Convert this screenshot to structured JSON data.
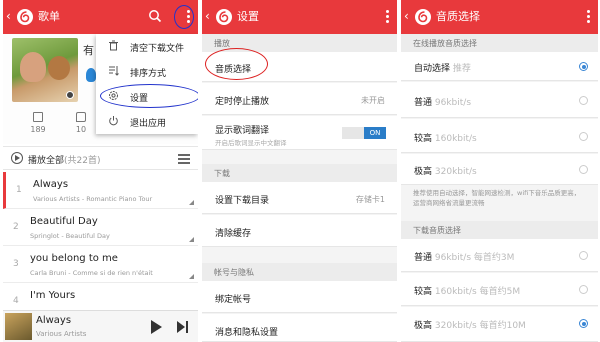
{
  "colors": {
    "accent": "#e8393c",
    "toggle_on": "#2a7dc8",
    "highlight_circle": "#2233cc",
    "radio_checked": "#3a86d4"
  },
  "songlist_screen": {
    "back_icon": "‹",
    "title": "歌单",
    "cover_title": "有",
    "stats": [
      {
        "icon": "favorite-icon",
        "count": "189"
      },
      {
        "icon": "comment-icon",
        "count": "10"
      }
    ],
    "play_all_label": "播放全部",
    "play_all_count": "(共22首)",
    "songs": [
      {
        "number": "1",
        "title": "Always",
        "meta": "Various Artists - Romantic Piano Tour"
      },
      {
        "number": "2",
        "title": "Beautiful Day",
        "meta": "Springlot - Beautiful Day"
      },
      {
        "number": "3",
        "title": "you belong to me",
        "meta": "Carla Bruni - Comme si de rien n'était"
      },
      {
        "number": "4",
        "title": "I'm Yours",
        "meta": ""
      }
    ],
    "now_playing": {
      "title": "Always",
      "artist": "Various Artists"
    },
    "menu": [
      {
        "icon": "trash-icon",
        "label": "清空下载文件"
      },
      {
        "icon": "sort-icon",
        "label": "排序方式"
      },
      {
        "icon": "gear-icon",
        "label": "设置"
      },
      {
        "icon": "power-icon",
        "label": "退出应用"
      }
    ]
  },
  "settings_screen": {
    "back_icon": "‹",
    "title": "设置",
    "sections": {
      "playback": "播放",
      "download": "下载",
      "account": "帐号与隐私"
    },
    "rows": {
      "quality": "音质选择",
      "sleep_timer": "定时停止播放",
      "sleep_timer_value": "未开启",
      "lyrics_translation": "显示歌词翻译",
      "lyrics_translation_desc": "开启后歌词显示中文翻译",
      "lyrics_toggle_state": "ON",
      "download_dir": "设置下载目录",
      "download_dir_value": "存储卡1",
      "clear_cache": "清除缓存",
      "bind_account": "绑定帐号",
      "notification": "消息和隐私设置"
    }
  },
  "quality_screen": {
    "back_icon": "‹",
    "title": "音质选择",
    "online_section": "在线播放音质选择",
    "online_options": [
      {
        "label": "自动选择",
        "sub": "推荐",
        "checked": true
      },
      {
        "label": "普通",
        "sub": "96kbit/s",
        "checked": false
      },
      {
        "label": "较高",
        "sub": "160kbit/s",
        "checked": false
      },
      {
        "label": "极高",
        "sub": "320kbit/s",
        "checked": false
      }
    ],
    "note": "推荐使用自动选择，智能网速检测，wifi下音乐品质更高，运营商网络省流量更流畅",
    "download_section": "下载音质选择",
    "download_options": [
      {
        "label": "普通",
        "sub": "96kbit/s 每首约3M",
        "checked": false
      },
      {
        "label": "较高",
        "sub": "160kbit/s 每首约5M",
        "checked": false
      },
      {
        "label": "极高",
        "sub": "320kbit/s 每首约10M",
        "checked": true
      }
    ]
  }
}
